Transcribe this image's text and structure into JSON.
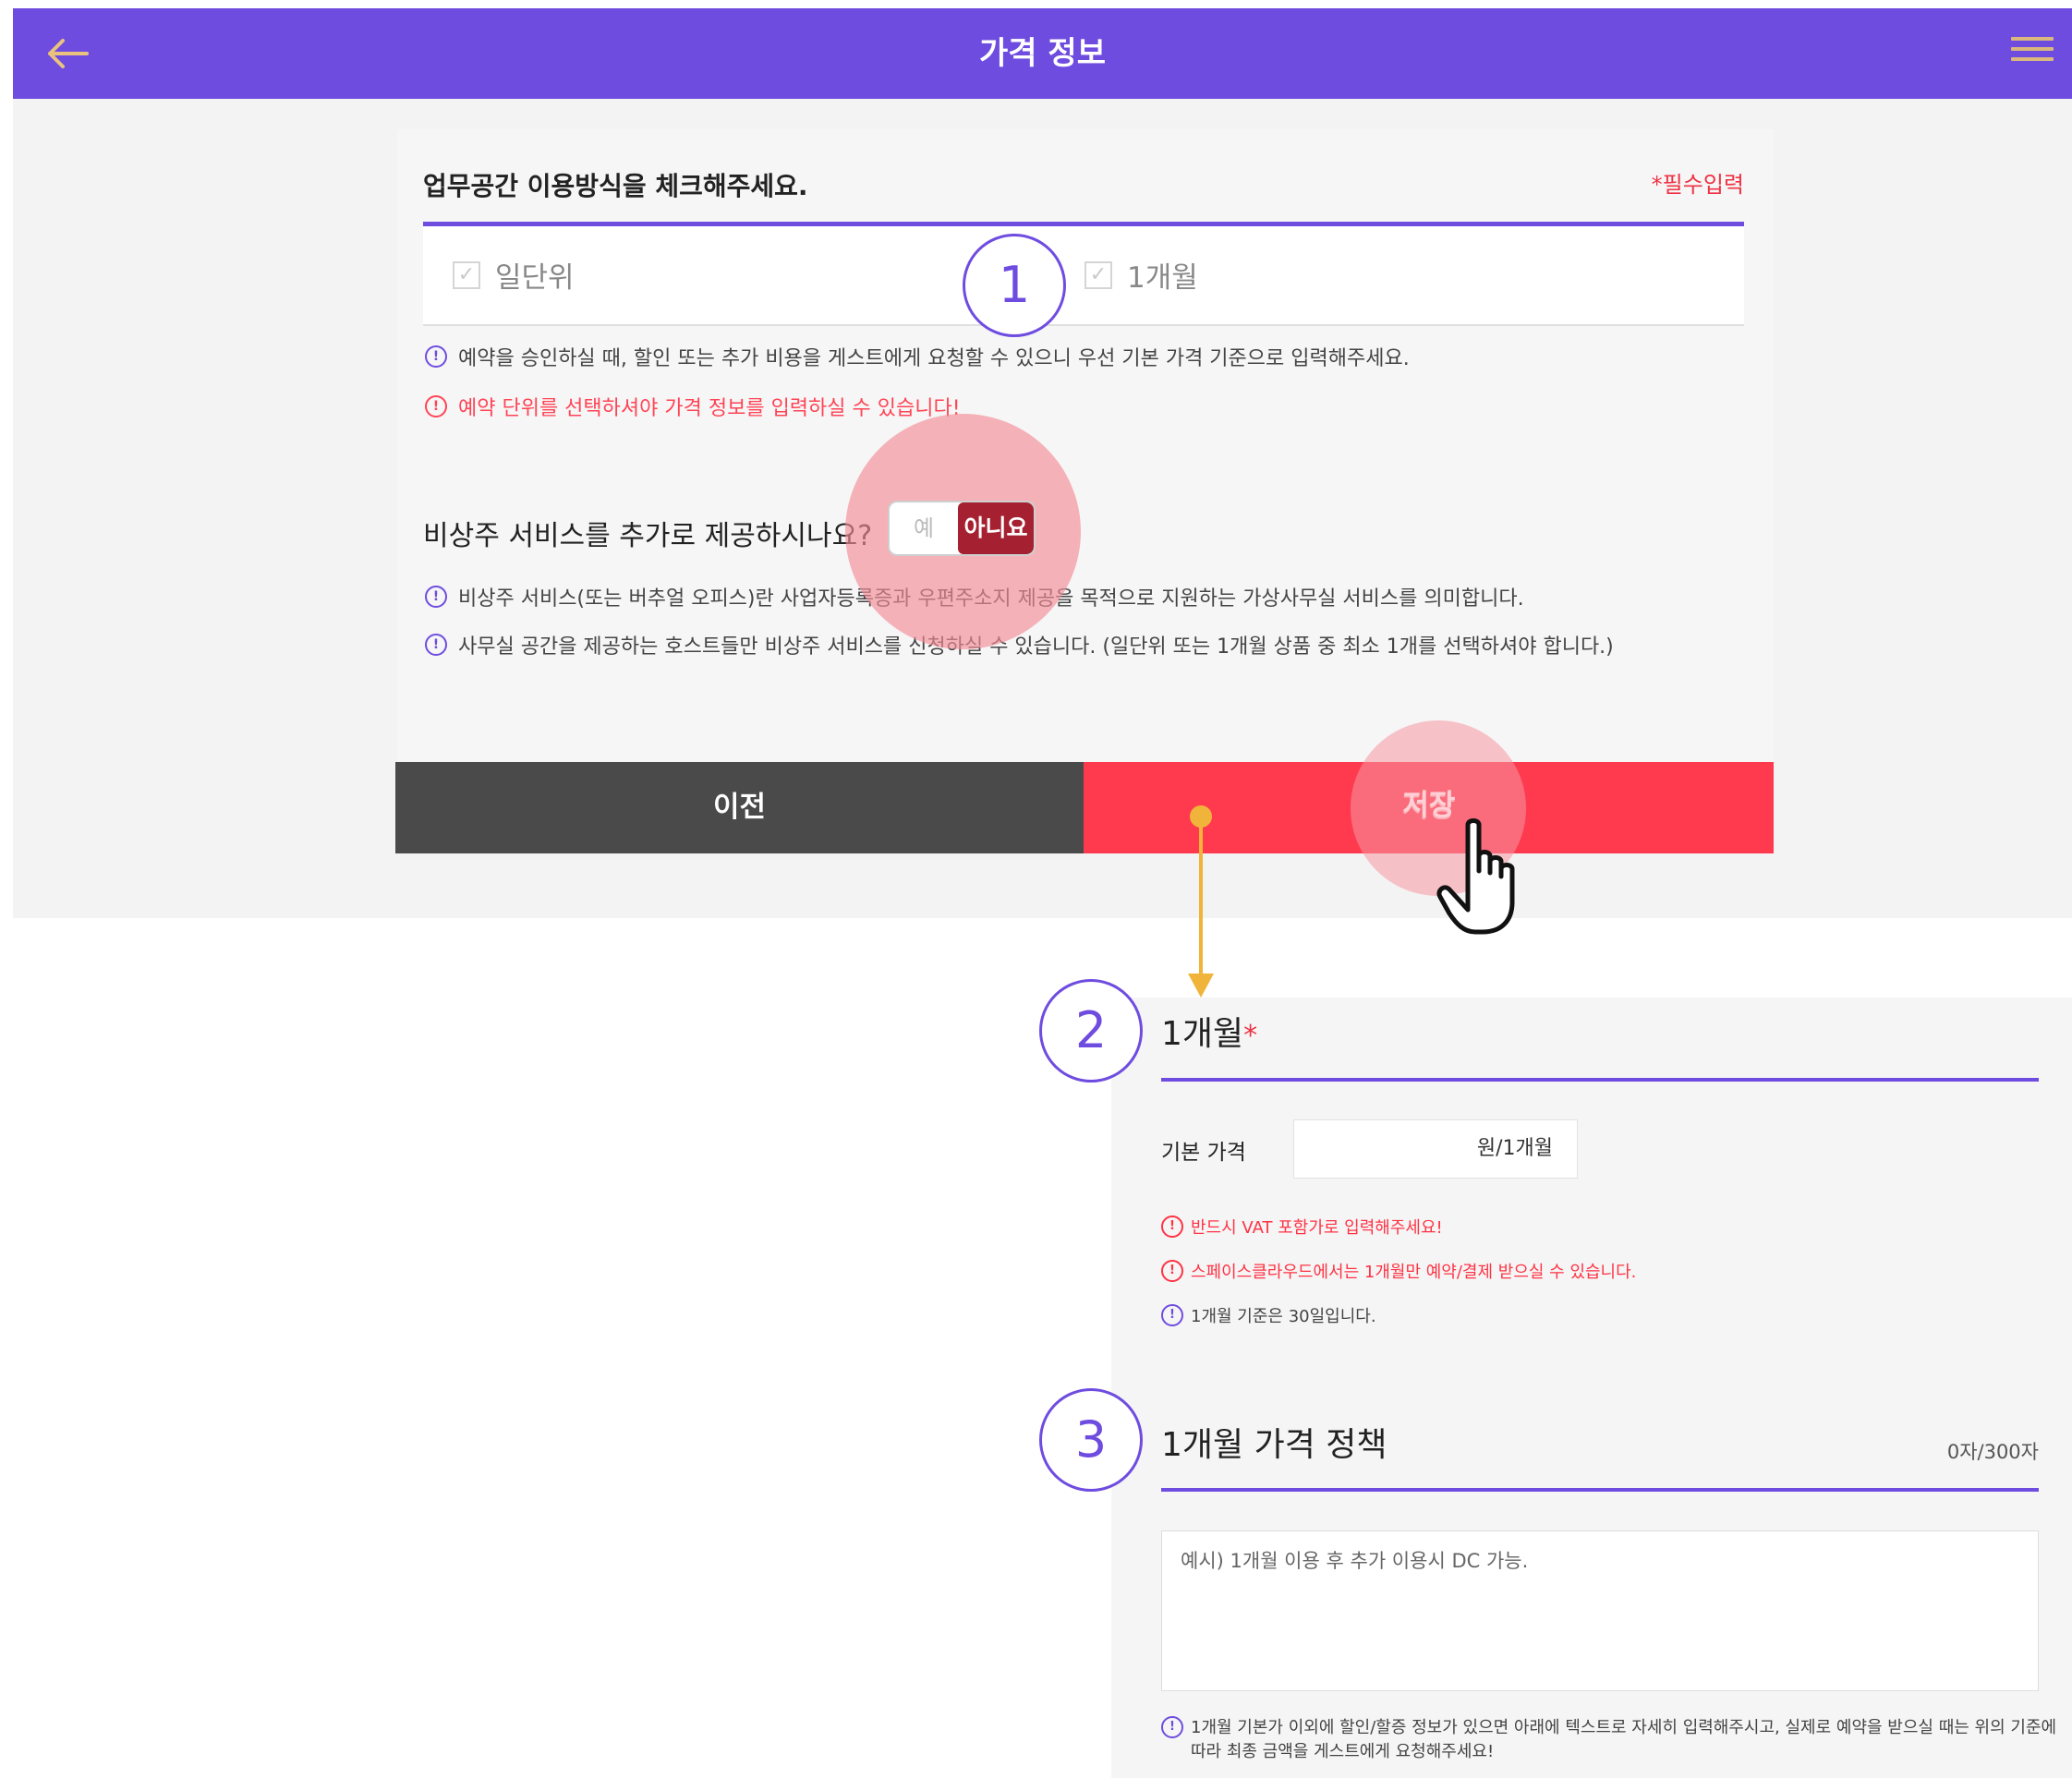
{
  "header": {
    "title": "가격 정보",
    "back_icon": "arrow-left-icon",
    "menu_icon": "hamburger-menu-icon",
    "bg_color": "#6f4ce0"
  },
  "usage": {
    "title": "업무공간 이용방식을 체크해주세요.",
    "required_note": "*필수입력",
    "options": [
      {
        "label": "일단위",
        "checked": false
      },
      {
        "label": "1개월",
        "checked": false
      }
    ],
    "notes": [
      {
        "text": "예약을 승인하실 때, 할인 또는 추가 비용을 게스트에게 요청할 수 있으니 우선 기본 가격 기준으로 입력해주세요.",
        "type": "info"
      },
      {
        "text": "예약 단위를 선택하셔야 가격 정보를 입력하실 수 있습니다!",
        "type": "warning"
      }
    ]
  },
  "virtual_service": {
    "question": "비상주 서비스를 추가로 제공하시나요?",
    "toggle_yes": "예",
    "toggle_no": "아니요",
    "selected": "아니요",
    "notes": [
      "비상주 서비스(또는 버추얼 오피스)란 사업자등록증과 우편주소지 제공을 목적으로 지원하는 가상사무실 서비스를 의미합니다.",
      "사무실 공간을 제공하는 호스트들만 비상주 서비스를 신청하실 수 있습니다. (일단위 또는 1개월 상품 중 최소 1개를 선택하셔야 합니다.)"
    ]
  },
  "buttons": {
    "prev": "이전",
    "save": "저장"
  },
  "steps": [
    "1",
    "2",
    "3"
  ],
  "monthly": {
    "title": "1개월",
    "required_mark": "*",
    "price_label": "기본 가격",
    "price_unit": "원/1개월",
    "notes": [
      {
        "text": "반드시 VAT 포함가로 입력해주세요!",
        "type": "warning"
      },
      {
        "text": "스페이스클라우드에서는 1개월만 예약/결제 받으실 수 있습니다.",
        "type": "warning"
      },
      {
        "text": "1개월 기준은 30일입니다.",
        "type": "info"
      }
    ]
  },
  "policy": {
    "title": "1개월 가격 정책",
    "char_count": "0자/300자",
    "placeholder": "예시) 1개월 이용 후 추가 이용시 DC 가능.",
    "note_line1": "1개월 기본가 이외에 할인/할증 정보가 있으면 아래에 텍스트로 자세히 입력해주시고, 실제로 예약을 받으실 때는 위의 기준에",
    "note_line2": "따라 최종 금액을 게스트에게 요청해주세요!"
  },
  "colors": {
    "accent": "#6f4ce0",
    "save": "#ff3a4e",
    "prev": "#4a4a4a",
    "warning": "#ff3344",
    "toggle_active": "#a52030",
    "arrow": "#f0b43a"
  }
}
